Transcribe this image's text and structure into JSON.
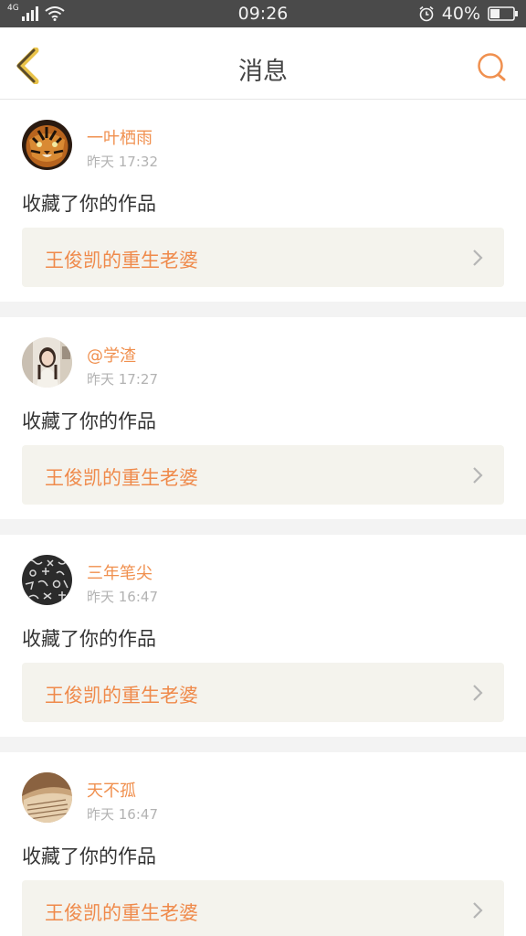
{
  "status_bar": {
    "network": "4G",
    "time": "09:26",
    "battery": "40%",
    "icons": [
      "signal-icon",
      "wifi-icon",
      "alarm-icon",
      "battery-icon"
    ]
  },
  "header": {
    "title": "消息",
    "back_icon": "chevron-left-icon",
    "search_icon": "search-icon",
    "accent_color": "#f0904f"
  },
  "messages": [
    {
      "user": "一叶栖雨",
      "time": "昨天 17:32",
      "action": "收藏了你的作品",
      "work": "王俊凯的重生老婆",
      "avatar": "tiger-avatar"
    },
    {
      "user": "@学渣",
      "time": "昨天 17:27",
      "action": "收藏了你的作品",
      "work": "王俊凯的重生老婆",
      "avatar": "girl-photo-avatar"
    },
    {
      "user": "三年笔尖",
      "time": "昨天 16:47",
      "action": "收藏了你的作品",
      "work": "王俊凯的重生老婆",
      "avatar": "pattern-avatar"
    },
    {
      "user": "天不孤",
      "time": "昨天 16:47",
      "action": "收藏了你的作品",
      "work": "王俊凯的重生老婆",
      "avatar": "book-avatar"
    }
  ]
}
